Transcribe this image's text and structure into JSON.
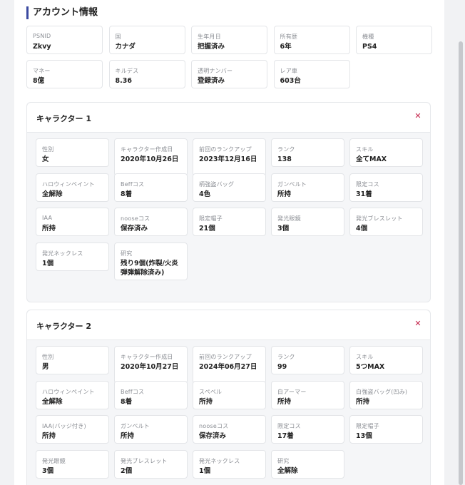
{
  "account": {
    "title": "アカウント情報",
    "fields": [
      {
        "label": "PSNID",
        "value": "Zkvy"
      },
      {
        "label": "国",
        "value": "カナダ"
      },
      {
        "label": "生年月日",
        "value": "把握済み"
      },
      {
        "label": "所有歴",
        "value": "6年"
      },
      {
        "label": "機種",
        "value": "PS4"
      },
      {
        "label": "マネー",
        "value": "8億"
      },
      {
        "label": "キルデス",
        "value": "8.36"
      },
      {
        "label": "透明ナンバー",
        "value": "登録済み"
      },
      {
        "label": "レア車",
        "value": "603台"
      }
    ]
  },
  "characters": [
    {
      "title": "キャラクター 1",
      "close_icon": "✕",
      "fields": [
        {
          "label": "性別",
          "value": "女"
        },
        {
          "label": "キャラクター作成日",
          "value": "2020年10月26日"
        },
        {
          "label": "前回のランクアップ",
          "value": "2023年12月16日"
        },
        {
          "label": "ランク",
          "value": "138"
        },
        {
          "label": "スキル",
          "value": "全てMAX"
        },
        {
          "label": "ハロウィンペイント",
          "value": "全解除"
        },
        {
          "label": "Beffコス",
          "value": "8着"
        },
        {
          "label": "柄強盗バッグ",
          "value": "4色"
        },
        {
          "label": "ガンベルト",
          "value": "所持"
        },
        {
          "label": "限定コス",
          "value": "31着"
        },
        {
          "label": "IAA",
          "value": "所持"
        },
        {
          "label": "nooseコス",
          "value": "保存済み"
        },
        {
          "label": "限定帽子",
          "value": "21個"
        },
        {
          "label": "発光眼鏡",
          "value": "3個"
        },
        {
          "label": "発光ブレスレット",
          "value": "4個"
        },
        {
          "label": "発光ネックレス",
          "value": "1個"
        },
        {
          "label": "研究",
          "value": "残り9個(炸裂/火炎弾弾解除済み)"
        }
      ]
    },
    {
      "title": "キャラクター 2",
      "close_icon": "✕",
      "fields": [
        {
          "label": "性別",
          "value": "男"
        },
        {
          "label": "キャラクター作成日",
          "value": "2020年10月27日"
        },
        {
          "label": "前回のランクアップ",
          "value": "2024年06月27日"
        },
        {
          "label": "ランク",
          "value": "99"
        },
        {
          "label": "スキル",
          "value": "5つMAX"
        },
        {
          "label": "ハロウィンペイント",
          "value": "全解除"
        },
        {
          "label": "Beffコス",
          "value": "8着"
        },
        {
          "label": "スペベル",
          "value": "所持"
        },
        {
          "label": "白アーマー",
          "value": "所持"
        },
        {
          "label": "白強盗バッグ(凹み)",
          "value": "所持"
        },
        {
          "label": "IAA(バッジ付き)",
          "value": "所持"
        },
        {
          "label": "ガンベルト",
          "value": "所持"
        },
        {
          "label": "nooseコス",
          "value": "保存済み"
        },
        {
          "label": "限定コス",
          "value": "17着"
        },
        {
          "label": "限定帽子",
          "value": "13個"
        },
        {
          "label": "発光眼鏡",
          "value": "3個"
        },
        {
          "label": "発光ブレスレット",
          "value": "2個"
        },
        {
          "label": "発光ネックレス",
          "value": "1個"
        },
        {
          "label": "研究",
          "value": "全解除"
        }
      ]
    }
  ]
}
